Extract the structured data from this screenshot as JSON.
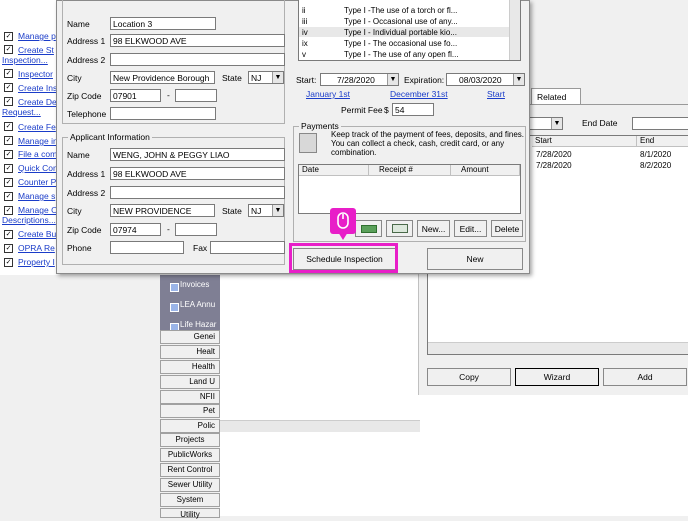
{
  "left_nav": {
    "items": [
      "Manage p",
      "Create St",
      "Inspection...",
      "Inspector",
      "Create Ins",
      "Create De",
      "Request...",
      "Create Fe",
      "Manage in",
      "File a com",
      "Quick Com",
      "Counter P",
      "Manage s",
      "Manage O",
      "Descriptions...",
      "Create Bu",
      "OPRA Re",
      "Property I"
    ]
  },
  "side_panel": {
    "items": [
      "Invoices",
      "LEA Annu",
      "Life Hazar"
    ]
  },
  "categories": [
    "Genei",
    "Healt",
    "Health",
    "Land U",
    "NFII",
    "Pet",
    "Polic",
    "Projects",
    "PublicWorks",
    "Rent Control",
    "Sewer Utility",
    "System",
    "Utility"
  ],
  "right_panel": {
    "tab": "Related",
    "end_date_label": "End Date",
    "columns": [
      "Start",
      "End"
    ],
    "rows": [
      {
        "start": "7/28/2020",
        "end": "8/1/2020"
      },
      {
        "start": "7/28/2020",
        "end": "8/2/2020"
      }
    ],
    "buttons": {
      "copy": "Copy",
      "wizard": "Wizard",
      "add": "Add"
    }
  },
  "permit_location": {
    "name_label": "Name",
    "name": "Location 3",
    "address1_label": "Address 1",
    "address1": "98 ELKWOOD AVE",
    "address2_label": "Address 2",
    "address2": "",
    "city_label": "City",
    "city": "New Providence Borough",
    "state_label": "State",
    "state": "NJ",
    "zip_label": "Zip Code",
    "zip": "07901",
    "zip_ext": "",
    "telephone_label": "Telephone",
    "telephone": ""
  },
  "applicant": {
    "title": "Applicant Information",
    "name_label": "Name",
    "name": "WENG, JOHN & PEGGY LIAO",
    "address1_label": "Address 1",
    "address1": "98 ELKWOOD AVE",
    "address2_label": "Address 2",
    "address2": "",
    "city_label": "City",
    "city": "NEW PROVIDENCE",
    "state_label": "State",
    "state": "NJ",
    "zip_label": "Zip Code",
    "zip": "07974",
    "zip_ext": "",
    "phone_label": "Phone",
    "phone": "",
    "fax_label": "Fax",
    "fax": ""
  },
  "permit_types": {
    "rows": [
      {
        "code": "ii",
        "desc": "Type I -The use of a torch or fl..."
      },
      {
        "code": "iii",
        "desc": "Type I - Occasional use of any..."
      },
      {
        "code": "iv",
        "desc": "Type I - Individual portable kio..."
      },
      {
        "code": "ix",
        "desc": "Type I - The occasional use fo..."
      },
      {
        "code": "v",
        "desc": "Type I - The use of any open fl..."
      }
    ]
  },
  "dates": {
    "start_label": "Start:",
    "start": "7/28/2020",
    "expiration_label": "Expiration:",
    "expiration": "08/03/2020",
    "link_january": "January 1st",
    "link_december": "December 31st",
    "link_start": "Start",
    "fee_label": "Permit Fee",
    "fee_currency": "$",
    "fee": "54"
  },
  "payments": {
    "title": "Payments",
    "description": "Keep track of the payment of fees, deposits, and fines. You can collect a check, cash, credit card, or any combination.",
    "columns": [
      "Date",
      "Receipt #",
      "Amount"
    ],
    "buttons": {
      "new": "New...",
      "edit": "Edit...",
      "delete": "Delete"
    }
  },
  "footer_buttons": {
    "schedule_inspection": "Schedule Inspection",
    "new": "New"
  },
  "colors": {
    "highlight": "#e81ec8",
    "link": "#1a3cc9",
    "title_bar": "#0a246a",
    "side_panel": "#7f7f94"
  }
}
